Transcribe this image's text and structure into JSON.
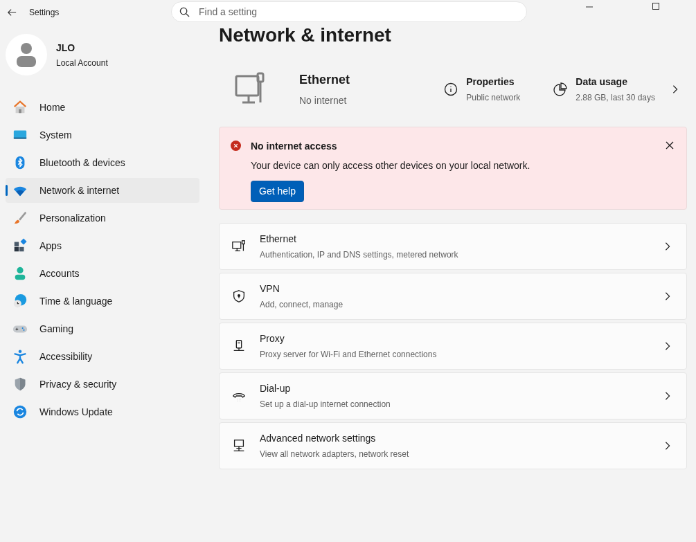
{
  "window": {
    "title": "Settings"
  },
  "search": {
    "placeholder": "Find a setting"
  },
  "account": {
    "name": "JLO",
    "type": "Local Account"
  },
  "nav": [
    {
      "label": "Home",
      "kind": "home",
      "selected": false
    },
    {
      "label": "System",
      "kind": "system",
      "selected": false
    },
    {
      "label": "Bluetooth & devices",
      "kind": "bluetooth",
      "selected": false
    },
    {
      "label": "Network & internet",
      "kind": "network",
      "selected": true
    },
    {
      "label": "Personalization",
      "kind": "brush",
      "selected": false
    },
    {
      "label": "Apps",
      "kind": "apps",
      "selected": false
    },
    {
      "label": "Accounts",
      "kind": "accounts",
      "selected": false
    },
    {
      "label": "Time & language",
      "kind": "time",
      "selected": false
    },
    {
      "label": "Gaming",
      "kind": "gaming",
      "selected": false
    },
    {
      "label": "Accessibility",
      "kind": "accessibility",
      "selected": false
    },
    {
      "label": "Privacy & security",
      "kind": "shield",
      "selected": false
    },
    {
      "label": "Windows Update",
      "kind": "update",
      "selected": false
    }
  ],
  "page_title": "Network & internet",
  "connection": {
    "name": "Ethernet",
    "status": "No internet",
    "properties": {
      "title": "Properties",
      "value": "Public network"
    },
    "data_usage": {
      "title": "Data usage",
      "value": "2.88 GB, last 30 days"
    }
  },
  "alert": {
    "title": "No internet access",
    "message": "Your device can only access other devices on your local network.",
    "button": "Get help"
  },
  "settings": [
    {
      "kind": "ethernet",
      "title": "Ethernet",
      "subtitle": "Authentication, IP and DNS settings, metered network"
    },
    {
      "kind": "vpn",
      "title": "VPN",
      "subtitle": "Add, connect, manage"
    },
    {
      "kind": "proxy",
      "title": "Proxy",
      "subtitle": "Proxy server for Wi-Fi and Ethernet connections"
    },
    {
      "kind": "dialup",
      "title": "Dial-up",
      "subtitle": "Set up a dial-up internet connection"
    },
    {
      "kind": "advanced",
      "title": "Advanced network settings",
      "subtitle": "View all network adapters, network reset"
    }
  ]
}
